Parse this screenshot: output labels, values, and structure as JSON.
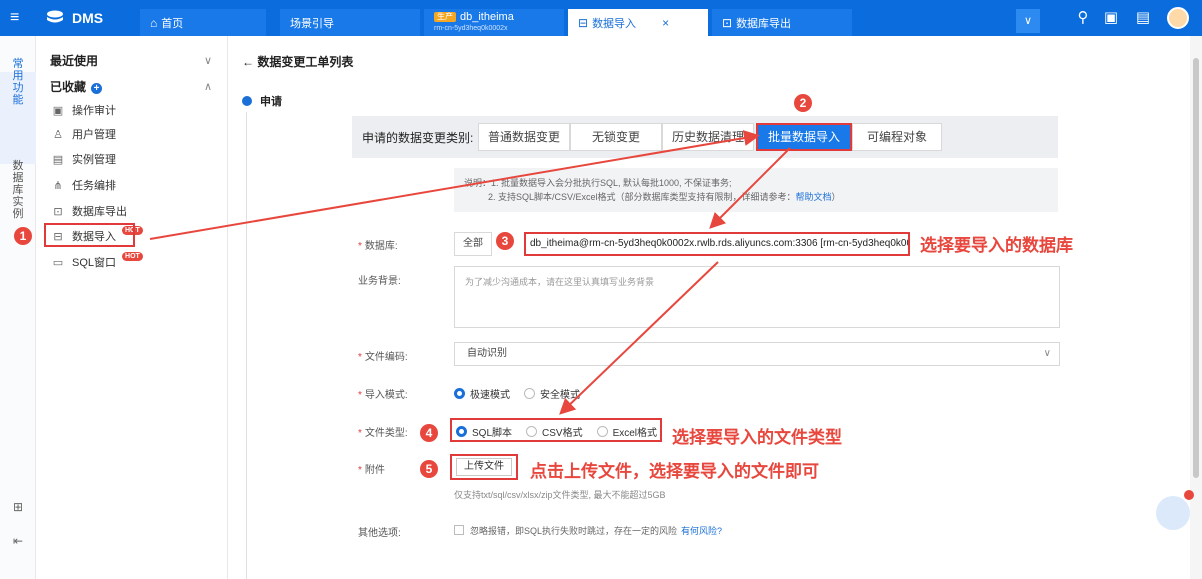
{
  "topbar": {
    "logo": "DMS",
    "tabs": [
      {
        "label": "首页",
        "icon": "home-icon"
      },
      {
        "label": "场景引导"
      },
      {
        "env": "生产",
        "label": "db_itheima",
        "sub": "rm-cn-5yd3heq0k0002x"
      },
      {
        "label": "数据导入",
        "icon": "import-icon",
        "close": "×"
      },
      {
        "label": "数据库导出",
        "icon": "export-icon"
      }
    ],
    "more": "∨"
  },
  "rail": {
    "group1": "常用功能",
    "group2": "数据库实例"
  },
  "nav": {
    "recent": "最近使用",
    "favorites": "已收藏",
    "plus": "+",
    "items": [
      {
        "label": "操作审计",
        "icon": "audit-icon"
      },
      {
        "label": "用户管理",
        "icon": "user-icon"
      },
      {
        "label": "实例管理",
        "icon": "instance-icon"
      },
      {
        "label": "任务编排",
        "icon": "task-flow-icon"
      },
      {
        "label": "数据库导出",
        "icon": "db-export-icon"
      },
      {
        "label": "数据导入",
        "icon": "data-import-icon",
        "hot": "HOT"
      },
      {
        "label": "SQL窗口",
        "icon": "sql-window-icon",
        "hot": "HOT"
      }
    ]
  },
  "main": {
    "back_title": "← 数据变更工单列表",
    "step": "申请",
    "type_label": "申请的数据变更类别:",
    "types": [
      "普通数据变更",
      "无锁变更",
      "历史数据清理",
      "批量数据导入",
      "可编程对象"
    ],
    "selected_type": "批量数据导入",
    "note_line1": "说明：1. 批量数据导入会分批执行SQL, 默认每批1000, 不保证事务;",
    "note_line2": "2. 支持SQL脚本/CSV/Excel格式（部分数据库类型支持有限制，详细请参考：",
    "note_link": "帮助文档",
    "note_end": "）",
    "db_label": "数据库:",
    "db_scope": "全部",
    "db_value": "db_itheima@rm-cn-5yd3heq0k0002x.rwlb.rds.aliyuncs.com:3306 [rm-cn-5yd3heq0k0002x]",
    "bg_label": "业务背景:",
    "bg_placeholder": "为了减少沟通成本，请在这里认真填写业务背景",
    "enc_label": "文件编码:",
    "enc_value": "自动识别",
    "mode_label": "导入模式:",
    "modes": [
      "极速模式",
      "安全模式"
    ],
    "filetype_label": "文件类型:",
    "filetypes": [
      "SQL脚本",
      "CSV格式",
      "Excel格式"
    ],
    "attach_label": "附件",
    "upload_label": "上传文件",
    "upload_hint": "仅支持txt/sql/csv/xlsx/zip文件类型, 最大不能超过5GB",
    "other_label": "其他选项:",
    "other_text": "忽略报错，即SQL执行失败时跳过，存在一定的风险",
    "other_link": "有何风险?"
  },
  "annotations": {
    "badges": [
      "1",
      "2",
      "3",
      "4",
      "5"
    ],
    "db_hint": "选择要导入的数据库",
    "filetype_hint": "选择要导入的文件类型",
    "upload_hint": "点击上传文件，选择要导入的文件即可"
  },
  "colors": {
    "brand": "#0a6cdd",
    "accent": "#1979e8",
    "annotation": "#e8473e"
  }
}
